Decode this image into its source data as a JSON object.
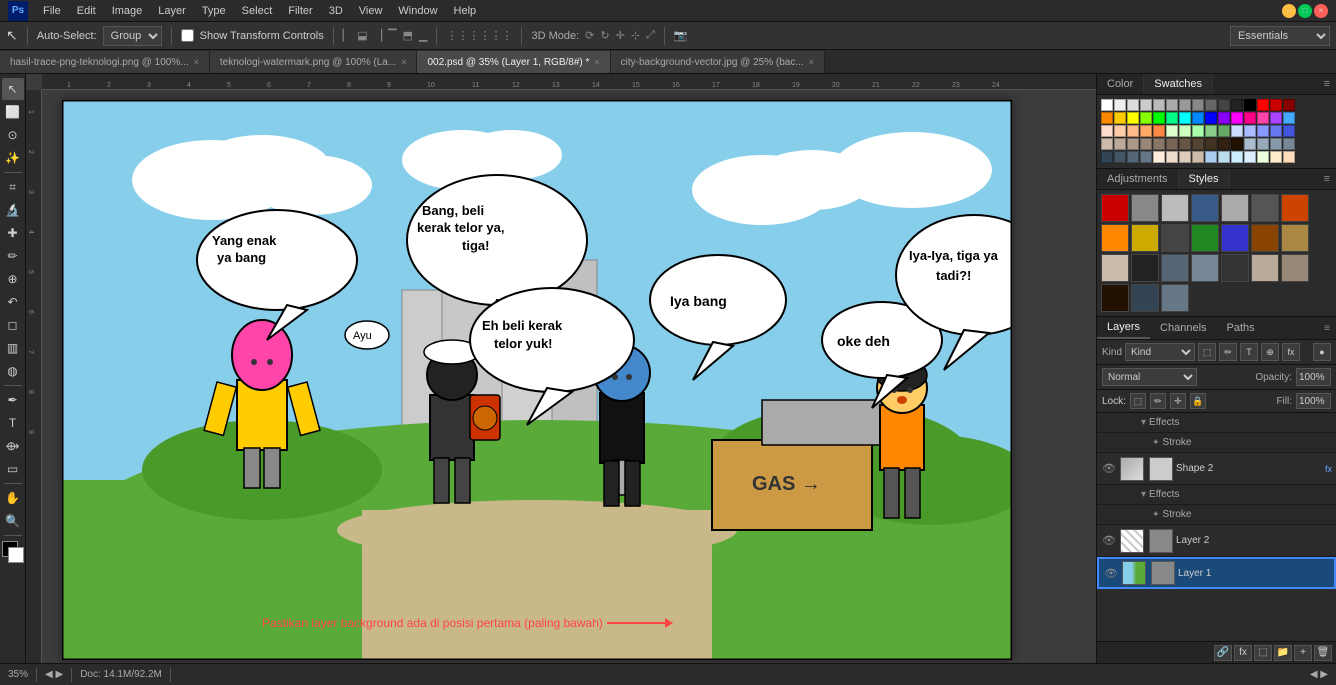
{
  "window": {
    "title": "Adobe Photoshop",
    "controls": {
      "min": "–",
      "max": "□",
      "close": "×"
    }
  },
  "menu": {
    "app_icon": "Ps",
    "items": [
      "File",
      "Edit",
      "Image",
      "Layer",
      "Type",
      "Select",
      "Filter",
      "3D",
      "View",
      "Window",
      "Help"
    ]
  },
  "options_bar": {
    "tool_icon": "↖",
    "auto_select_label": "Auto-Select:",
    "group_value": "Group",
    "show_transform_label": "Show Transform Controls",
    "workspace": "Essentials"
  },
  "tabs": [
    {
      "label": "hasil-trace-png-teknologi.png @ 100%...",
      "active": false
    },
    {
      "label": "teknologi-watermark.png @ 100% (La...",
      "active": false
    },
    {
      "label": "002.psd @ 35% (Layer 1, RGB/8#) *",
      "active": true
    },
    {
      "label": "city-background-vector.jpg @ 25% (bac...",
      "active": false
    }
  ],
  "color_panel": {
    "tab_color": "Color",
    "tab_swatches": "Swatches",
    "active_tab": "Swatches"
  },
  "adjustments_panel": {
    "tab_adjustments": "Adjustments",
    "tab_styles": "Styles",
    "active_tab": "Styles"
  },
  "layers_panel": {
    "tab_layers": "Layers",
    "tab_channels": "Channels",
    "tab_paths": "Paths",
    "active_tab": "Layers",
    "kind_label": "Kind",
    "blend_mode": "Normal",
    "opacity_label": "Opacity:",
    "opacity_value": "100%",
    "lock_label": "Lock:",
    "fill_label": "Fill:",
    "fill_value": "100%",
    "layers": [
      {
        "name": "Effects",
        "type": "effects-group",
        "visible": true,
        "indent": 20
      },
      {
        "name": "Stroke",
        "type": "effect",
        "visible": true,
        "indent": 30
      },
      {
        "name": "Shape 2",
        "type": "shape",
        "visible": true,
        "has_fx": true,
        "active": false
      },
      {
        "name": "Effects",
        "type": "effects-group",
        "visible": true,
        "indent": 20
      },
      {
        "name": "Stroke",
        "type": "effect",
        "visible": true,
        "indent": 30
      },
      {
        "name": "Layer 2",
        "type": "layer",
        "visible": true,
        "active": false
      },
      {
        "name": "Layer 1",
        "type": "layer",
        "visible": true,
        "active": true,
        "selected": true
      }
    ]
  },
  "status_bar": {
    "zoom": "35%",
    "doc_info": "Doc: 14.1M/92.2M"
  },
  "annotation": {
    "text": "Pastikan layer background ada di posisi pertama (paling bawah)"
  },
  "swatches_colors": [
    [
      "#ffffff",
      "#000000",
      "#ff0000",
      "#00ff00",
      "#0000ff",
      "#ffff00",
      "#ff00ff",
      "#00ffff",
      "#ff8800",
      "#88ff00",
      "#0088ff",
      "#ff0088",
      "#8800ff",
      "#00ff88"
    ],
    [
      "#cccccc",
      "#333333",
      "#cc0000",
      "#00cc00",
      "#0000cc",
      "#cccc00",
      "#cc00cc",
      "#00cccc",
      "#cc6600",
      "#66cc00",
      "#0066cc",
      "#cc0066",
      "#6600cc",
      "#00cc66"
    ],
    [
      "#aaaaaa",
      "#555555",
      "#aa0000",
      "#00aa00",
      "#0000aa",
      "#aaaa00",
      "#aa00aa",
      "#00aaaa",
      "#aa4400",
      "#44aa00",
      "#0044aa",
      "#aa0044",
      "#4400aa",
      "#00aa44"
    ],
    [
      "#888888",
      "#777777",
      "#880000",
      "#008800",
      "#000088",
      "#888800",
      "#880088",
      "#008888",
      "#884400",
      "#448800",
      "#004488",
      "#880044",
      "#440088",
      "#008844"
    ],
    [
      "#ffeedd",
      "#ddeeff",
      "#ffdded",
      "#ddfde0",
      "#eeddff",
      "#fff0dd",
      "#ddffee",
      "#eeffdd",
      "#ffddee",
      "#ddeeff",
      "#ffeedd",
      "#ddffee",
      "#eeddff",
      "#ffddee"
    ]
  ],
  "styles_items": [
    {
      "bg": "#cc0000"
    },
    {
      "bg": "#888888"
    },
    {
      "bg": "#bbbbbb"
    },
    {
      "bg": "#3a5a8a"
    },
    {
      "bg": "#aaaaaa"
    },
    {
      "bg": "#555555"
    },
    {
      "bg": "#cc4400"
    },
    {
      "bg": "#ff8800"
    },
    {
      "bg": "#ccaa00"
    },
    {
      "bg": "#444444"
    },
    {
      "bg": "#228822"
    },
    {
      "bg": "#3333cc"
    },
    {
      "bg": "#884400"
    },
    {
      "bg": "#aa8844"
    },
    {
      "bg": "#ccbbaa"
    },
    {
      "bg": "#222222"
    },
    {
      "bg": "#556677"
    },
    {
      "bg": "#778899"
    },
    {
      "bg": "#333333"
    },
    {
      "bg": "#bbaa99"
    },
    {
      "bg": "#998877"
    },
    {
      "bg": "#221100"
    },
    {
      "bg": "#334455"
    },
    {
      "bg": "#667788"
    }
  ]
}
